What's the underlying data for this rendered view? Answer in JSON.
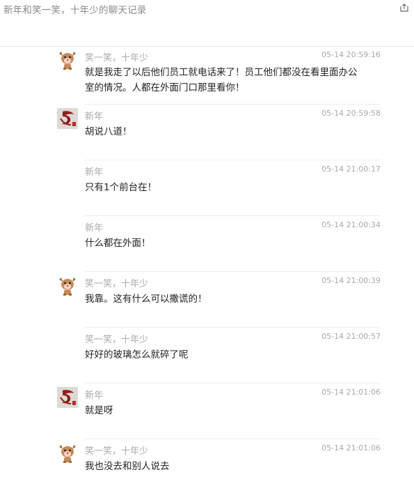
{
  "window": {
    "title": "新年和笑一笑，十年少的聊天记录"
  },
  "messages": [
    {
      "sender": "笑一笑，十年少",
      "time": "05-14 20:59:16",
      "text": "就是我走了以后他们员工就电话来了！员工他们都没在看里面办公室的情况。人都在外面门口那里看你！",
      "avatar": "cartoon-avatar"
    },
    {
      "sender": "新年",
      "time": "05-14 20:59:58",
      "text": "胡说八道！",
      "avatar": "calligraphy-avatar"
    },
    {
      "sender": "新年",
      "time": "05-14 21:00:17",
      "text": "只有1个前台在！",
      "avatar": ""
    },
    {
      "sender": "新年",
      "time": "05-14 21:00:34",
      "text": "什么都在外面！",
      "avatar": ""
    },
    {
      "sender": "笑一笑，十年少",
      "time": "05-14 21:00:39",
      "text": "我靠。这有什么可以撒谎的！",
      "avatar": "cartoon-avatar"
    },
    {
      "sender": "笑一笑，十年少",
      "time": "05-14 21:00:57",
      "text": "好好的玻璃怎么就碎了呢",
      "avatar": ""
    },
    {
      "sender": "新年",
      "time": "05-14 21:01:06",
      "text": "就是呀",
      "avatar": "calligraphy-avatar"
    },
    {
      "sender": "笑一笑，十年少",
      "time": "05-14 21:01:06",
      "text": "我也没去和别人说去",
      "avatar": "cartoon-avatar"
    }
  ],
  "icons": {
    "export": "export-icon"
  }
}
